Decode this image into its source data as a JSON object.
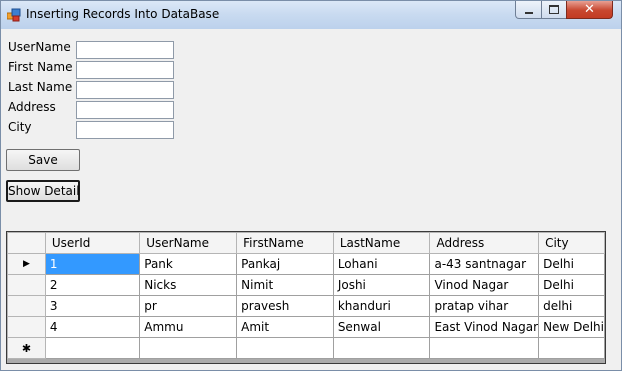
{
  "window": {
    "title": "Inserting Records Into DataBase"
  },
  "form": {
    "labels": {
      "username": "UserName",
      "firstname": "First Name",
      "lastname": "Last Name",
      "address": "Address",
      "city": "City"
    },
    "values": {
      "username": "",
      "firstname": "",
      "lastname": "",
      "address": "",
      "city": ""
    },
    "save_label": "Save",
    "show_detail_label": "Show Detail"
  },
  "grid": {
    "columns": [
      "UserId",
      "UserName",
      "FirstName",
      "LastName",
      "Address",
      "City"
    ],
    "rows": [
      [
        "1",
        "Pank",
        "Pankaj",
        "Lohani",
        "a-43 santnagar",
        "Delhi"
      ],
      [
        "2",
        "Nicks",
        "Nimit",
        "Joshi",
        "Vinod Nagar",
        "Delhi"
      ],
      [
        "3",
        "pr",
        "pravesh",
        "khanduri",
        "pratap vihar",
        "delhi"
      ],
      [
        "4",
        "Ammu",
        "Amit",
        "Senwal",
        "East Vinod Nagar",
        "New Delhi"
      ]
    ],
    "current_row_indicator": "▶",
    "new_row_indicator": "✱",
    "selected_cell": {
      "row": 0,
      "col": 0
    }
  },
  "colors": {
    "selection": "#3399ff",
    "titlebar": "#c8daf0",
    "close_button": "#c8472f"
  }
}
